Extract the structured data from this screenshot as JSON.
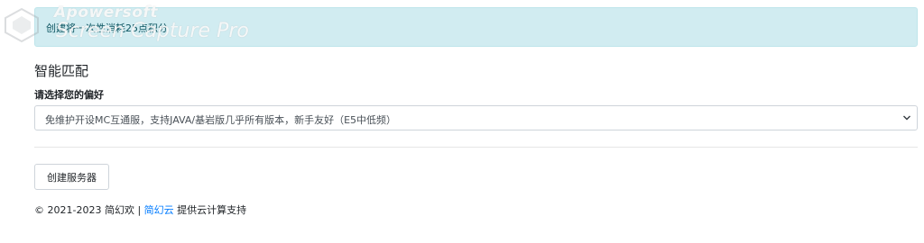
{
  "alert": {
    "text": "创建将一次性消耗25点积分"
  },
  "watermark": {
    "line1": "Apowersoft",
    "line2": "Screen Capture Pro"
  },
  "section": {
    "title": "智能匹配"
  },
  "form": {
    "label": "请选择您的偏好",
    "select_value": "免维护开设MC互通服，支持JAVA/基岩版几乎所有版本，新手友好（E5中低频）"
  },
  "actions": {
    "create_button": "创建服务器"
  },
  "footer": {
    "copyright": "© 2021-2023 简幻欢 | ",
    "link": "简幻云",
    "suffix": " 提供云计算支持"
  },
  "colors": {
    "alert_bg": "#d1ecf1",
    "alert_text": "#0c5460",
    "link": "#007bff"
  }
}
